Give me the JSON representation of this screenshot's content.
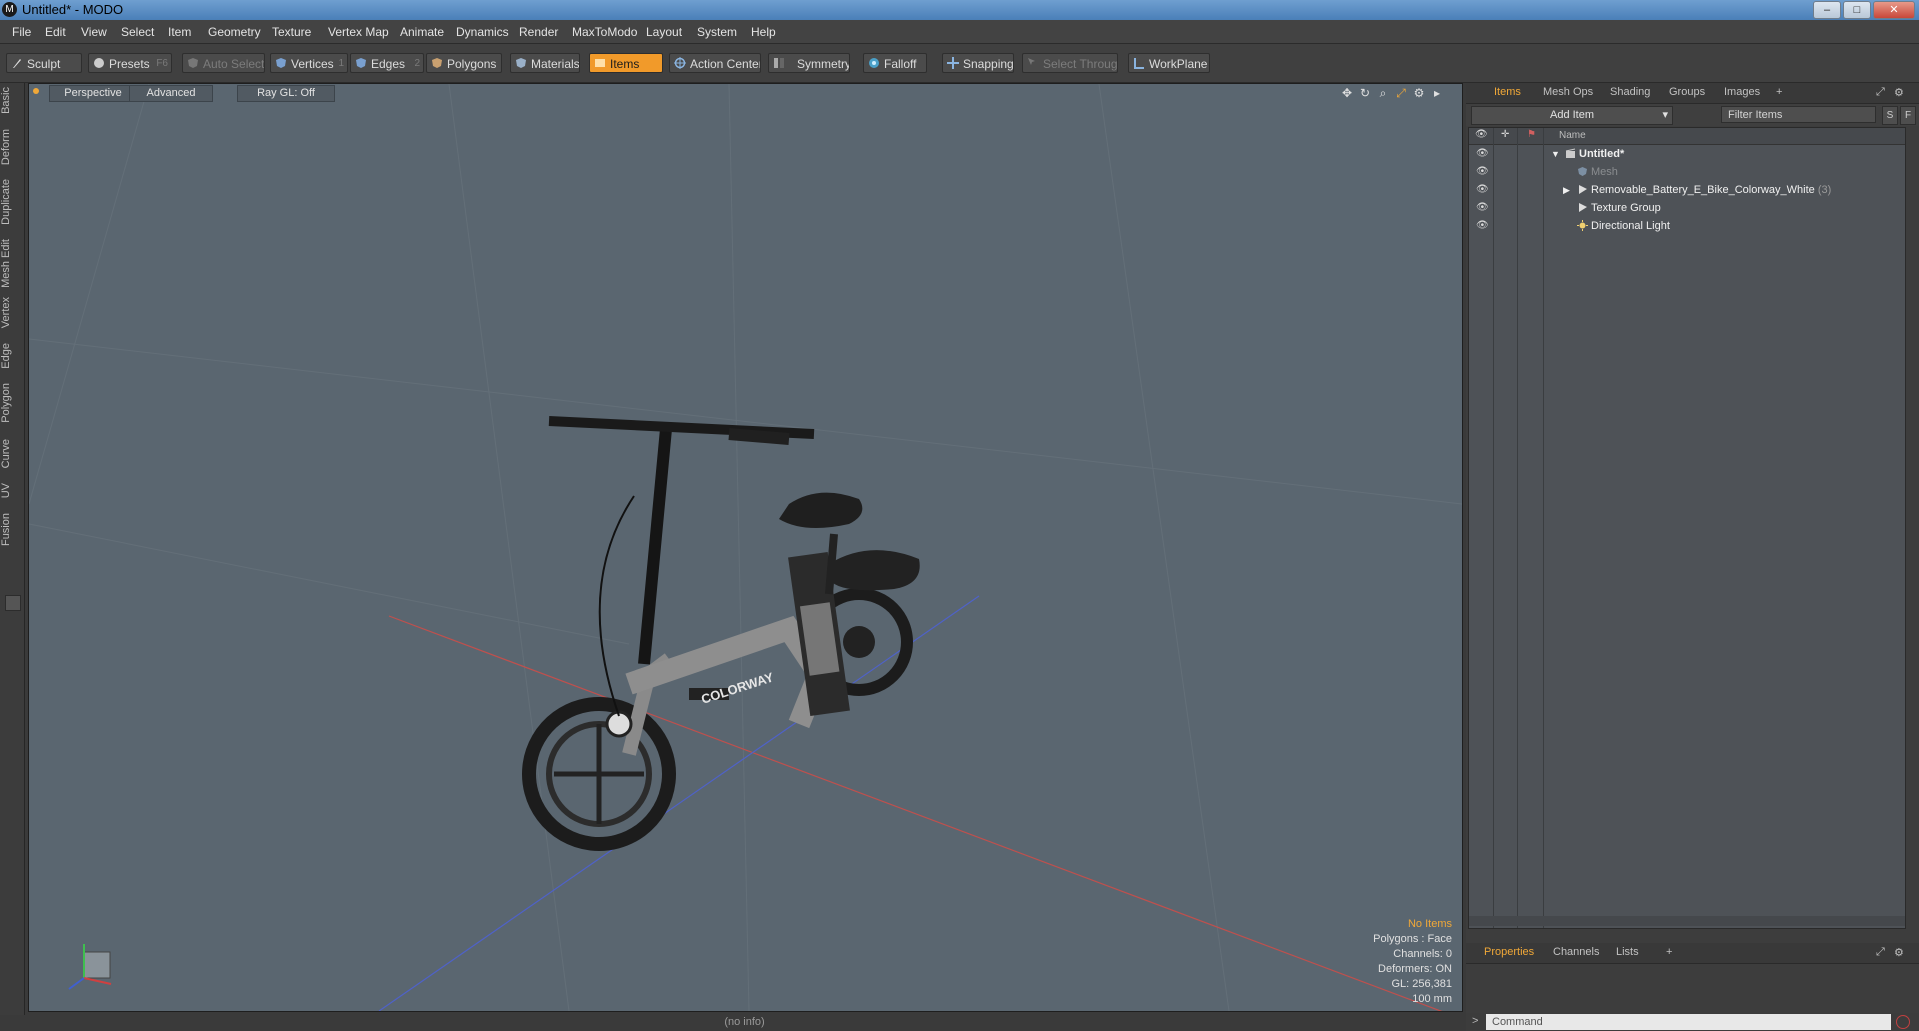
{
  "window": {
    "title": "Untitled* - MODO",
    "logo": "M",
    "min": "–",
    "max": "□",
    "close": "✕"
  },
  "menu": [
    "File",
    "Edit",
    "View",
    "Select",
    "Item",
    "Geometry",
    "Texture",
    "Vertex Map",
    "Animate",
    "Dynamics",
    "Render",
    "MaxToModo",
    "Layout",
    "System",
    "Help"
  ],
  "toolbar": {
    "sculpt": "Sculpt",
    "presets": "Presets",
    "presets_key": "F6",
    "auto_select": "Auto Select",
    "vertices": "Vertices",
    "vertices_key": "1",
    "edges": "Edges",
    "edges_key": "2",
    "polygons": "Polygons",
    "materials": "Materials",
    "items": "Items",
    "action_center": "Action Center",
    "symmetry": "Symmetry",
    "falloff": "Falloff",
    "snapping": "Snapping",
    "select_through": "Select Through",
    "workplane": "WorkPlane"
  },
  "left_tabs": [
    "Basic",
    "Deform",
    "Duplicate",
    "Mesh Edit",
    "Vertex",
    "Edge",
    "Polygon",
    "Curve",
    "UV",
    "Fusion"
  ],
  "viewport": {
    "view_label": "Perspective",
    "shading_label": "Advanced",
    "raygl_label": "Ray GL: Off",
    "bike_brand": "COLORWAY",
    "info": {
      "selection": "No Items",
      "polygons": "Polygons : Face",
      "channels": "Channels: 0",
      "deformers": "Deformers: ON",
      "gl": "GL: 256,381",
      "scale": "100 mm"
    }
  },
  "status_bar": "(no info)",
  "right_panel": {
    "tabs": [
      "Items",
      "Mesh Ops",
      "Shading",
      "Groups",
      "Images"
    ],
    "add_tab": "+",
    "add_item_label": "Add Item",
    "filter_placeholder": "Filter Items",
    "s_btn": "S",
    "f_btn": "F",
    "name_header": "Name",
    "tree": [
      {
        "label": "Untitled*",
        "count": ""
      },
      {
        "label": "Mesh",
        "count": ""
      },
      {
        "label": "Removable_Battery_E_Bike_Colorway_White",
        "count": "(3)"
      },
      {
        "label": "Texture Group",
        "count": ""
      },
      {
        "label": "Directional Light",
        "count": ""
      }
    ],
    "bottom_tabs": [
      "Properties",
      "Channels",
      "Lists"
    ],
    "command_prompt": ">",
    "command_placeholder": "Command"
  },
  "colors": {
    "accent": "#f19a2a",
    "viewport_bg": "#5a6670",
    "panel_bg": "#3d3d3d"
  }
}
